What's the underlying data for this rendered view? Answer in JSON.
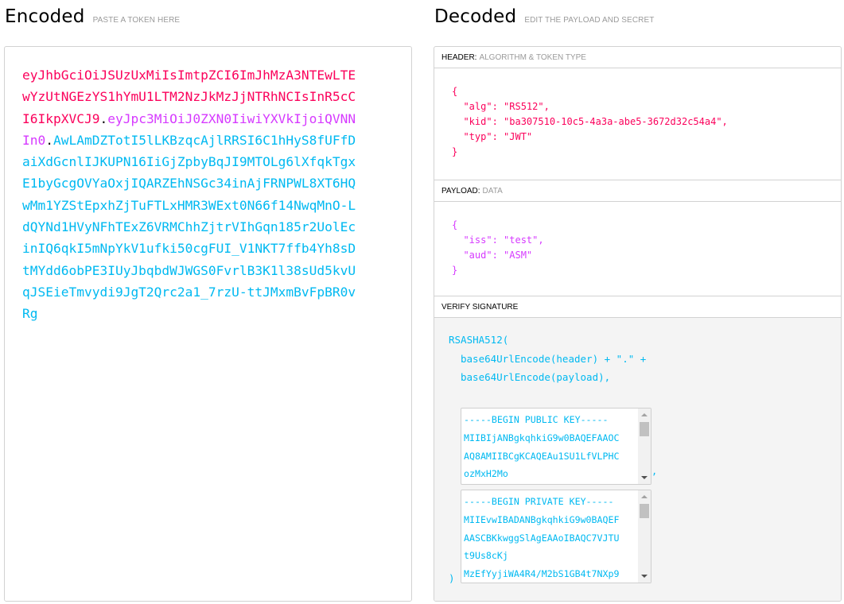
{
  "encoded": {
    "title": "Encoded",
    "subtitle": "PASTE A TOKEN HERE",
    "token": {
      "header": "eyJhbGciOiJSUzUxMiIsImtpZCI6ImJhMzA3NTEwLTEwYzUtNGEzYS1hYmU1LTM2NzJkMzJjNTRhNCIsInR5cCI6IkpXVCJ9",
      "dot1": ".",
      "payload": "eyJpc3MiOiJ0ZXN0IiwiYXVkIjoiQVNNIn0",
      "dot2": ".",
      "signature": "AwLAmDZTotI5lLKBzqcAjlRRSI6C1hHyS8fUFfDaiXdGcnlIJKUPN16IiGjZpbyBqJI9MTOLg6lXfqkTgxE1byGcgOVYaOxjIQARZEhNSGc34inAjFRNPWL8XT6HQwMm1YZStEpxhZjTuFTLxHMR3WExt0N66f14NwqMnO-LdQYNd1HVyNFhTExZ6VRMChhZjtrVIhGqn185r2UolEcinIQ6qkI5mNpYkV1ufki50cgFUI_V1NKT7ffb4Yh8sDtMYdd6obPE3IUyJbqbdWJWGS0FvrlB3K1l38sUd5kvUqJSEieTmvydi9JgT2Qrc2a1_7rzU-ttJMxmBvFpBR0vRg"
    },
    "colors": {
      "header": "#fb015b",
      "payload": "#d63aff",
      "signature": "#00b9f1"
    }
  },
  "decoded": {
    "title": "Decoded",
    "subtitle": "EDIT THE PAYLOAD AND SECRET",
    "header_section": {
      "label": "HEADER:",
      "sublabel": "ALGORITHM & TOKEN TYPE",
      "lines": [
        "{",
        "  \"alg\": \"RS512\",",
        "  \"kid\": \"ba307510-10c5-4a3a-abe5-3672d32c54a4\",",
        "  \"typ\": \"JWT\"",
        "}"
      ]
    },
    "payload_section": {
      "label": "PAYLOAD:",
      "sublabel": "DATA",
      "lines": [
        "{",
        "  \"iss\": \"test\",",
        "  \"aud\": \"ASM\"",
        "}"
      ]
    },
    "verify_section": {
      "label": "VERIFY SIGNATURE",
      "fn_open": "RSASHA512(",
      "line1": "base64UrlEncode(header) + \".\" +",
      "line2": "base64UrlEncode(payload),",
      "public_key_lines": [
        "-----BEGIN PUBLIC KEY-----",
        "MIIBIjANBgkqhkiG9w0BAQEFAAOC",
        "AQ8AMIIBCgKCAQEAu1SU1LfVLPHC",
        "ozMxH2Mo"
      ],
      "comma": ",",
      "private_key_lines": [
        "-----BEGIN PRIVATE KEY-----",
        "MIIEvwIBADANBgkqhkiG9w0BAQEF",
        "AASCBKkwggSlAgEAAoIBAQC7VJTU",
        "t9Us8cKj",
        "MzEfYyjiWA4R4/M2bS1GB4t7NXp9"
      ],
      "fn_close": ")"
    }
  }
}
